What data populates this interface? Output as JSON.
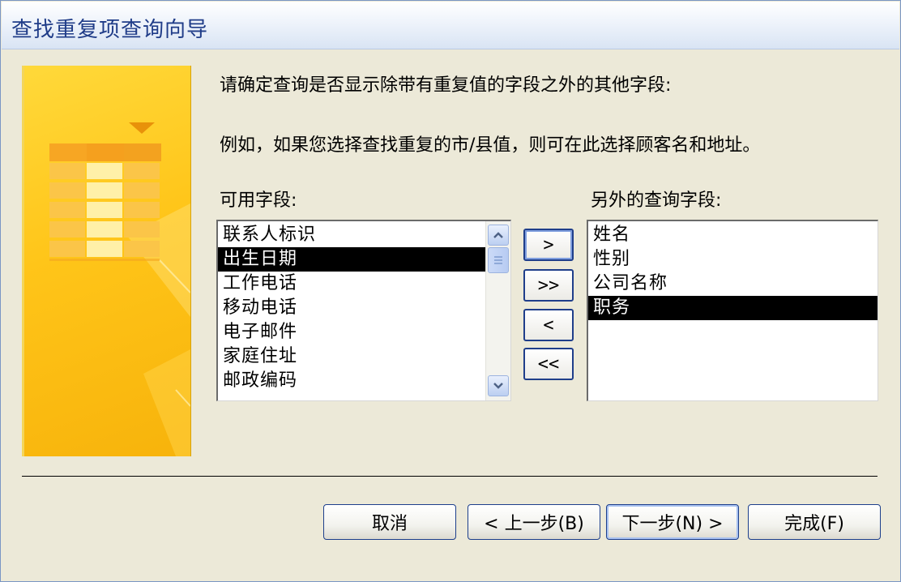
{
  "window": {
    "title": "查找重复项查询向导"
  },
  "prompt": {
    "line1": "请确定查询是否显示除带有重复值的字段之外的其他字段:",
    "line2": "例如，如果您选择查找重复的市/县值，则可在此选择顾客名和地址。"
  },
  "available": {
    "label": "可用字段:",
    "items": [
      "联系人标识",
      "出生日期",
      "工作电话",
      "移动电话",
      "电子邮件",
      "家庭住址",
      "邮政编码"
    ],
    "selected_index": 1
  },
  "additional": {
    "label": "另外的查询字段:",
    "items": [
      "姓名",
      "性别",
      "公司名称",
      "职务"
    ],
    "selected_index": 3
  },
  "move_buttons": {
    "add_one": ">",
    "add_all": ">>",
    "remove_one": "<",
    "remove_all": "<<"
  },
  "footer": {
    "cancel": "取消",
    "back": "< 上一步(B)",
    "next": "下一步(N) >",
    "finish": "完成(F)"
  },
  "icons": {
    "scroll_up": "chevron-up-icon",
    "scroll_down": "chevron-down-icon",
    "wizard_art": "table-wizard-icon"
  },
  "colors": {
    "title_text": "#1f3c88",
    "art_yellow": "#ffc519",
    "selection": "#000000",
    "button_border": "#1d3f8c"
  }
}
